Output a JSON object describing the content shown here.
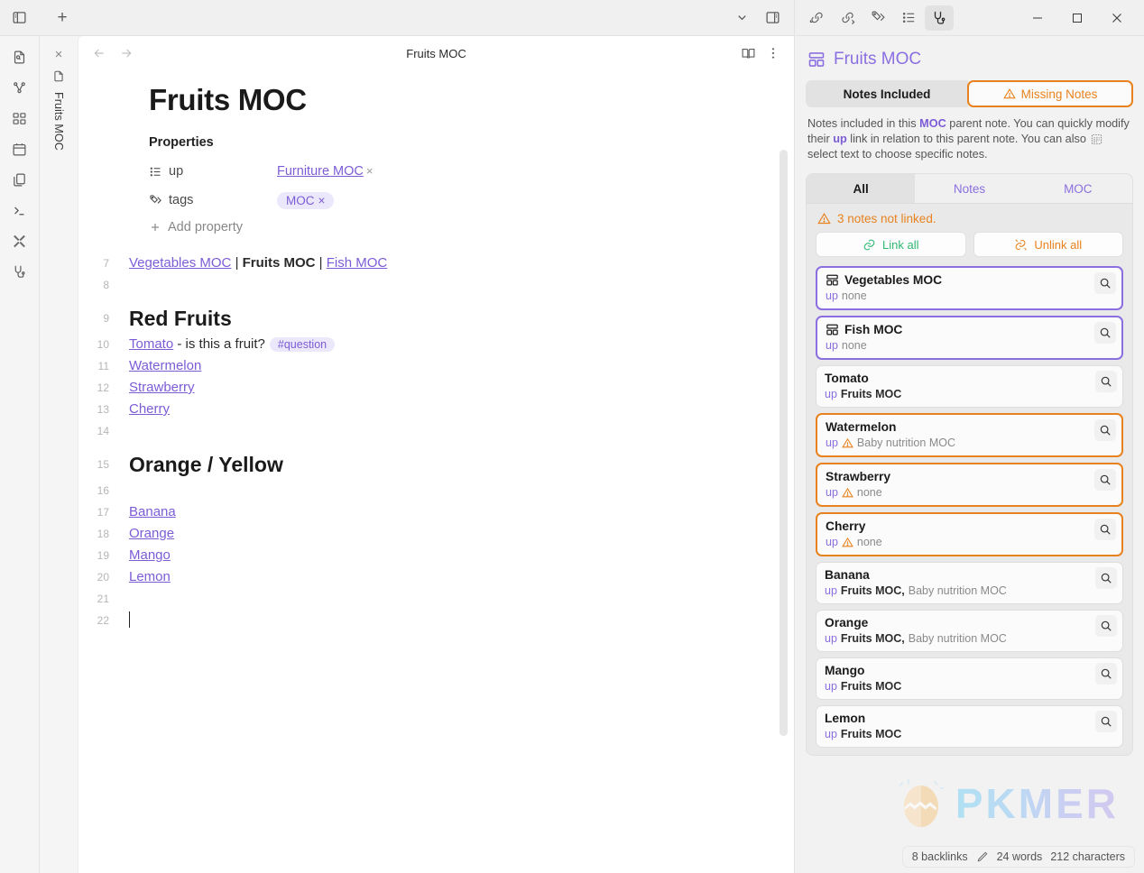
{
  "titlebar": {
    "sidebar_toggle_icon": "sidebar-left-icon",
    "new_tab_icon": "plus-icon",
    "chevron_icon": "chevron-down-icon",
    "right_sidebar_icon": "sidebar-right-icon"
  },
  "ribbon": {
    "toggle_icon": "sidebar-toggle-icon",
    "items": [
      {
        "icon": "file-search-icon",
        "name": "quick-switcher"
      },
      {
        "icon": "graph-icon",
        "name": "graph-view"
      },
      {
        "icon": "canvas-icon",
        "name": "canvas"
      },
      {
        "icon": "calendar-icon",
        "name": "daily-note"
      },
      {
        "icon": "copy-icon",
        "name": "templates"
      },
      {
        "icon": "terminal-icon",
        "name": "command-palette"
      },
      {
        "icon": "tools-icon",
        "name": "tools"
      },
      {
        "icon": "plug-icon",
        "name": "plugin"
      }
    ]
  },
  "tab": {
    "close_label": "×",
    "file_icon": "file-icon",
    "label": "Fruits MOC"
  },
  "note": {
    "back_icon": "arrow-left-icon",
    "forward_icon": "arrow-right-icon",
    "title": "Fruits MOC",
    "reading_icon": "book-open-icon",
    "more_icon": "more-vertical-icon",
    "doc_title": "Fruits MOC",
    "properties_label": "Properties",
    "properties": [
      {
        "icon": "list-icon",
        "key": "up",
        "value": "Furniture MOC",
        "type": "link",
        "remove": "×"
      },
      {
        "icon": "tags-icon",
        "key": "tags",
        "value": "MOC",
        "type": "tag",
        "remove": "×"
      }
    ],
    "add_property_label": "Add property",
    "add_property_icon": "plus-icon",
    "lines": [
      {
        "n": "7",
        "type": "text",
        "segments": [
          {
            "text": "Vegetables MOC",
            "style": "link"
          },
          {
            "text": " | ",
            "style": "plain"
          },
          {
            "text": "Fruits MOC",
            "style": "bold"
          },
          {
            "text": " | ",
            "style": "plain"
          },
          {
            "text": "Fish MOC",
            "style": "link"
          }
        ]
      },
      {
        "n": "8",
        "type": "text",
        "segments": []
      },
      {
        "n": "9",
        "type": "h2",
        "segments": [
          {
            "text": "Red Fruits",
            "style": "plain"
          }
        ]
      },
      {
        "n": "10",
        "type": "text",
        "segments": [
          {
            "text": "Tomato",
            "style": "link"
          },
          {
            "text": " - is this a fruit?",
            "style": "plain"
          },
          {
            "text": "#question",
            "style": "tag"
          }
        ]
      },
      {
        "n": "11",
        "type": "text",
        "segments": [
          {
            "text": "Watermelon",
            "style": "link"
          }
        ]
      },
      {
        "n": "12",
        "type": "text",
        "segments": [
          {
            "text": "Strawberry",
            "style": "link"
          }
        ]
      },
      {
        "n": "13",
        "type": "text",
        "segments": [
          {
            "text": "Cherry",
            "style": "link"
          }
        ]
      },
      {
        "n": "14",
        "type": "text",
        "segments": []
      },
      {
        "n": "15",
        "type": "h2",
        "segments": [
          {
            "text": "Orange / Yellow",
            "style": "plain"
          }
        ]
      },
      {
        "n": "16",
        "type": "text",
        "segments": []
      },
      {
        "n": "17",
        "type": "text",
        "segments": [
          {
            "text": "Banana",
            "style": "link"
          }
        ]
      },
      {
        "n": "18",
        "type": "text",
        "segments": [
          {
            "text": "Orange",
            "style": "link"
          }
        ]
      },
      {
        "n": "19",
        "type": "text",
        "segments": [
          {
            "text": "Mango",
            "style": "link"
          }
        ]
      },
      {
        "n": "20",
        "type": "text",
        "segments": [
          {
            "text": "Lemon",
            "style": "link"
          }
        ]
      },
      {
        "n": "21",
        "type": "text",
        "segments": []
      },
      {
        "n": "22",
        "type": "caret",
        "segments": []
      }
    ]
  },
  "rightbar": {
    "tab_icons": [
      {
        "icon": "incoming-link-icon",
        "name": "backlinks-tab",
        "active": false
      },
      {
        "icon": "outgoing-link-icon",
        "name": "outgoing-links-tab",
        "active": false
      },
      {
        "icon": "tags-icon",
        "name": "tags-tab",
        "active": false
      },
      {
        "icon": "outline-icon",
        "name": "outline-tab",
        "active": false
      },
      {
        "icon": "plug-icon",
        "name": "moc-plugin-tab",
        "active": true
      }
    ],
    "window": {
      "minimize": "—",
      "maximize": "□",
      "close": "✕"
    },
    "header": {
      "icon": "layout-dashboard-icon",
      "title": "Fruits MOC"
    },
    "segments": [
      {
        "label": "Notes Included",
        "active": true,
        "icon": null
      },
      {
        "label": "Missing Notes",
        "active": false,
        "icon": "warning-icon"
      }
    ],
    "description": {
      "part1": "Notes included in this ",
      "kw1": "MOC",
      "part2": " parent note. You can quickly modify their ",
      "kw2": "up",
      "part3": " link in relation to this parent note. You can also ",
      "icon": "select-text-icon",
      "part4": " select text to choose specific notes."
    },
    "filter_tabs": [
      {
        "label": "All",
        "active": true
      },
      {
        "label": "Notes",
        "active": false
      },
      {
        "label": "MOC",
        "active": false
      }
    ],
    "not_linked_text": "3 notes not linked.",
    "not_linked_icon": "warning-icon",
    "actions": [
      {
        "label": "Link all",
        "icon": "link-icon",
        "kind": "link"
      },
      {
        "label": "Unlink all",
        "icon": "unlink-icon",
        "kind": "unlink"
      }
    ],
    "cards": [
      {
        "title": "Vegetables MOC",
        "style": "moc",
        "icon": "layout-dashboard-icon",
        "up_label": "up",
        "warn": false,
        "values": [
          {
            "text": "none",
            "style": "dim"
          }
        ],
        "search_icon": "search-icon"
      },
      {
        "title": "Fish MOC",
        "style": "moc",
        "icon": "layout-dashboard-icon",
        "up_label": "up",
        "warn": false,
        "values": [
          {
            "text": "none",
            "style": "dim"
          }
        ],
        "search_icon": "search-icon"
      },
      {
        "title": "Tomato",
        "style": "plain",
        "icon": null,
        "up_label": "up",
        "warn": false,
        "values": [
          {
            "text": "Fruits MOC",
            "style": "strong"
          }
        ],
        "search_icon": "search-icon"
      },
      {
        "title": "Watermelon",
        "style": "warn",
        "icon": null,
        "up_label": "up",
        "warn": true,
        "values": [
          {
            "text": "Baby nutrition MOC",
            "style": "dim"
          }
        ],
        "search_icon": "search-icon"
      },
      {
        "title": "Strawberry",
        "style": "warn",
        "icon": null,
        "up_label": "up",
        "warn": true,
        "values": [
          {
            "text": "none",
            "style": "dim"
          }
        ],
        "search_icon": "search-icon"
      },
      {
        "title": "Cherry",
        "style": "warn",
        "icon": null,
        "up_label": "up",
        "warn": true,
        "values": [
          {
            "text": "none",
            "style": "dim"
          }
        ],
        "search_icon": "search-icon"
      },
      {
        "title": "Banana",
        "style": "plain",
        "icon": null,
        "up_label": "up",
        "warn": false,
        "values": [
          {
            "text": "Fruits MOC,",
            "style": "strong"
          },
          {
            "text": "Baby nutrition MOC",
            "style": "dim"
          }
        ],
        "search_icon": "search-icon"
      },
      {
        "title": "Orange",
        "style": "plain",
        "icon": null,
        "up_label": "up",
        "warn": false,
        "values": [
          {
            "text": "Fruits MOC,",
            "style": "strong"
          },
          {
            "text": "Baby nutrition MOC",
            "style": "dim"
          }
        ],
        "search_icon": "search-icon"
      },
      {
        "title": "Mango",
        "style": "plain",
        "icon": null,
        "up_label": "up",
        "warn": false,
        "values": [
          {
            "text": "Fruits MOC",
            "style": "strong"
          }
        ],
        "search_icon": "search-icon"
      },
      {
        "title": "Lemon",
        "style": "plain",
        "icon": null,
        "up_label": "up",
        "warn": false,
        "values": [
          {
            "text": "Fruits MOC",
            "style": "strong"
          }
        ],
        "search_icon": "search-icon"
      }
    ],
    "watermark": {
      "text": "PKMER",
      "icon": "egg-logo-icon"
    },
    "status": {
      "backlinks": "8 backlinks",
      "edit_icon": "pencil-icon",
      "words": "24 words",
      "characters": "212 characters"
    }
  },
  "colors": {
    "accent_purple": "#8b6fe0",
    "warn_orange": "#e8821e",
    "link_green": "#2eb872",
    "link_purple": "#7c5cd6"
  }
}
